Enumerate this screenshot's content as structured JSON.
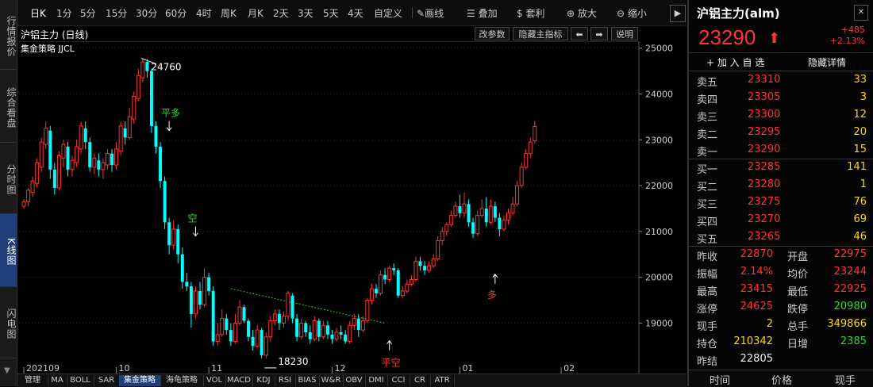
{
  "left_tabs": [
    "行情报价",
    "综合看盘",
    "分时图",
    "K线图",
    "闪电图"
  ],
  "toolbar": {
    "periods": [
      "日K",
      "1分",
      "5分",
      "15分",
      "30分",
      "60分",
      "4时",
      "周K",
      "月K",
      "2天",
      "3天",
      "5天",
      "4天",
      "自定义"
    ],
    "draw": "画线",
    "overlay": "叠加",
    "arbitrage": "套利",
    "zoom_in": "放大",
    "zoom_out": "缩小"
  },
  "chart_header": {
    "title": "沪铝主力 (日线)",
    "indicator": "集金策略 JJCL",
    "buttons": [
      "改参数",
      "隐藏主指标",
      "⬅",
      "➡",
      "说明"
    ]
  },
  "chart_data": {
    "type": "candlestick",
    "ylim": [
      17900,
      25150
    ],
    "y_ticks": [
      19000,
      20000,
      21000,
      22000,
      23000,
      24000,
      25000
    ],
    "x_labels": [
      {
        "label": "202109",
        "index": 0
      },
      {
        "label": "10",
        "index": 21
      },
      {
        "label": "11",
        "index": 42
      },
      {
        "label": "12",
        "index": 70
      },
      {
        "label": "01",
        "index": 99
      },
      {
        "label": "02",
        "index": 122
      }
    ],
    "candles": [
      [
        21550,
        21650,
        21500,
        21700
      ],
      [
        21650,
        21900,
        21550,
        21950
      ],
      [
        21850,
        22100,
        21750,
        22200
      ],
      [
        22050,
        22500,
        21950,
        22600
      ],
      [
        22400,
        22950,
        22300,
        23050
      ],
      [
        22900,
        23250,
        22800,
        23400
      ],
      [
        23200,
        22350,
        22150,
        23300
      ],
      [
        22350,
        21950,
        21800,
        22500
      ],
      [
        21950,
        22650,
        21900,
        22750
      ],
      [
        22600,
        22900,
        22400,
        23000
      ],
      [
        22850,
        22350,
        22200,
        22950
      ],
      [
        22350,
        22550,
        22200,
        22650
      ],
      [
        22500,
        22850,
        22400,
        23000
      ],
      [
        22800,
        23300,
        22700,
        23400
      ],
      [
        23250,
        22950,
        22800,
        23400
      ],
      [
        22950,
        22400,
        22300,
        23050
      ],
      [
        22400,
        22600,
        22250,
        22700
      ],
      [
        22550,
        22350,
        22200,
        22700
      ],
      [
        22350,
        22500,
        22150,
        22600
      ],
      [
        22450,
        22700,
        22350,
        22800
      ],
      [
        22700,
        22450,
        22300,
        22800
      ],
      [
        22450,
        22800,
        22350,
        22950
      ],
      [
        22750,
        23300,
        22650,
        23400
      ],
      [
        23250,
        23050,
        22900,
        23400
      ],
      [
        23050,
        23500,
        23000,
        23700
      ],
      [
        23450,
        23950,
        23350,
        24050
      ],
      [
        23900,
        24400,
        23850,
        24550
      ],
      [
        24350,
        24700,
        24250,
        24760
      ],
      [
        24700,
        24500,
        24350,
        24760
      ],
      [
        24500,
        23300,
        23150,
        24550
      ],
      [
        23300,
        22850,
        22700,
        23400
      ],
      [
        22850,
        22100,
        21950,
        22950
      ],
      [
        22100,
        21200,
        21050,
        22200
      ],
      [
        21200,
        20700,
        20500,
        21300
      ],
      [
        20700,
        21050,
        20600,
        21250
      ],
      [
        21050,
        20500,
        20300,
        21150
      ],
      [
        20500,
        19900,
        19750,
        20650
      ],
      [
        19900,
        19800,
        19700,
        20100
      ],
      [
        19800,
        19200,
        18900,
        19900
      ],
      [
        19200,
        19700,
        19100,
        19800
      ],
      [
        19700,
        19400,
        19300,
        19900
      ],
      [
        19400,
        20000,
        19350,
        20200
      ],
      [
        20000,
        19700,
        19600,
        20100
      ],
      [
        19700,
        18600,
        18500,
        19800
      ],
      [
        18600,
        18750,
        18500,
        19000
      ],
      [
        18750,
        19100,
        18700,
        19300
      ],
      [
        19100,
        18850,
        18750,
        19200
      ],
      [
        18850,
        18600,
        18500,
        19000
      ],
      [
        18600,
        19000,
        18550,
        19200
      ],
      [
        19000,
        19350,
        18950,
        19500
      ],
      [
        19350,
        19050,
        19000,
        19400
      ],
      [
        19050,
        18700,
        18600,
        19100
      ],
      [
        18700,
        18500,
        18400,
        18850
      ],
      [
        18500,
        18850,
        18450,
        18950
      ],
      [
        18850,
        18300,
        18230,
        18900
      ],
      [
        18300,
        18700,
        18230,
        18800
      ],
      [
        18700,
        19050,
        18600,
        19150
      ],
      [
        19050,
        19200,
        18950,
        19300
      ],
      [
        19200,
        19000,
        18850,
        19300
      ],
      [
        19000,
        19150,
        18900,
        19250
      ],
      [
        19150,
        19650,
        19050,
        19700
      ],
      [
        19600,
        19100,
        19000,
        19650
      ],
      [
        19100,
        18700,
        18600,
        19200
      ],
      [
        18700,
        19000,
        18650,
        19100
      ],
      [
        19000,
        18800,
        18700,
        19050
      ],
      [
        18800,
        18650,
        18550,
        18950
      ],
      [
        18650,
        19050,
        18600,
        19150
      ],
      [
        19050,
        18700,
        18600,
        19100
      ],
      [
        18700,
        18950,
        18650,
        19050
      ],
      [
        18950,
        18750,
        18650,
        19050
      ],
      [
        18750,
        18650,
        18550,
        18850
      ],
      [
        18650,
        18800,
        18600,
        18900
      ],
      [
        18800,
        18750,
        18650,
        18950
      ],
      [
        18750,
        18600,
        18550,
        18850
      ],
      [
        18600,
        18950,
        18550,
        19050
      ],
      [
        18950,
        19100,
        18850,
        19200
      ],
      [
        19100,
        18850,
        18700,
        19200
      ],
      [
        18850,
        19050,
        18800,
        19150
      ],
      [
        19050,
        19500,
        19000,
        19550
      ],
      [
        19500,
        19750,
        19400,
        19850
      ],
      [
        19750,
        19650,
        19550,
        19850
      ],
      [
        19650,
        20050,
        19600,
        20150
      ],
      [
        20050,
        19950,
        19850,
        20200
      ],
      [
        19950,
        20200,
        19900,
        20250
      ],
      [
        20200,
        20150,
        20050,
        20300
      ],
      [
        20150,
        19600,
        19550,
        20200
      ],
      [
        19600,
        19700,
        19550,
        19800
      ],
      [
        19700,
        19850,
        19650,
        19950
      ],
      [
        19850,
        19950,
        19800,
        20050
      ],
      [
        19950,
        20350,
        19900,
        20450
      ],
      [
        20350,
        20250,
        20150,
        20450
      ],
      [
        20250,
        20150,
        20050,
        20350
      ],
      [
        20150,
        20250,
        20100,
        20350
      ],
      [
        20250,
        20400,
        20200,
        20500
      ],
      [
        20400,
        20800,
        20350,
        20900
      ],
      [
        20800,
        21000,
        20700,
        21100
      ],
      [
        21000,
        21150,
        20900,
        21200
      ],
      [
        21150,
        21350,
        21100,
        21450
      ],
      [
        21350,
        21550,
        21300,
        21650
      ],
      [
        21550,
        21400,
        21300,
        21800
      ],
      [
        21400,
        21600,
        21300,
        21850
      ],
      [
        21600,
        21200,
        21100,
        21700
      ],
      [
        21200,
        20950,
        20850,
        21300
      ],
      [
        20950,
        21350,
        20900,
        21450
      ],
      [
        21350,
        21500,
        21300,
        21700
      ],
      [
        21500,
        21200,
        21100,
        21750
      ],
      [
        21200,
        21550,
        21150,
        21700
      ],
      [
        21550,
        21300,
        21200,
        21650
      ],
      [
        21300,
        21050,
        20900,
        21400
      ],
      [
        21050,
        21250,
        21000,
        21350
      ],
      [
        21250,
        21400,
        21150,
        21500
      ],
      [
        21400,
        21600,
        21350,
        21750
      ],
      [
        21600,
        22000,
        21550,
        22100
      ],
      [
        22000,
        22400,
        21950,
        22500
      ],
      [
        22400,
        22700,
        22350,
        22800
      ],
      [
        22700,
        22950,
        22600,
        23050
      ],
      [
        22975,
        23290,
        22925,
        23415
      ]
    ],
    "annotations": {
      "high_label": "24760",
      "low_label": "18230",
      "signals": [
        "平多",
        "空",
        "平空",
        "多"
      ]
    }
  },
  "indicator_tabs": [
    "管理",
    "MA",
    "BOLL",
    "SAR",
    "集金策略",
    "海龟策略",
    "VOL",
    "MACD",
    "KDJ",
    "RSI",
    "BIAS",
    "W&R",
    "OBV",
    "DMI",
    "CCI",
    "CR",
    "ATR"
  ],
  "quote": {
    "title": "沪铝主力(alm)",
    "price": "23290",
    "change": "+485",
    "change_pct": "+2.13%",
    "add_favorite": "+ 加 入 自 选",
    "hide_detail": "隐藏详情",
    "asks": [
      {
        "label": "卖五",
        "price": "23310",
        "vol": "33"
      },
      {
        "label": "卖四",
        "price": "23305",
        "vol": "3"
      },
      {
        "label": "卖三",
        "price": "23300",
        "vol": "12"
      },
      {
        "label": "卖二",
        "price": "23295",
        "vol": "20"
      },
      {
        "label": "卖一",
        "price": "23290",
        "vol": "15"
      }
    ],
    "bids": [
      {
        "label": "买一",
        "price": "23285",
        "vol": "141"
      },
      {
        "label": "买二",
        "price": "23280",
        "vol": "1"
      },
      {
        "label": "买三",
        "price": "23275",
        "vol": "76"
      },
      {
        "label": "买四",
        "price": "23270",
        "vol": "69"
      },
      {
        "label": "买五",
        "price": "23265",
        "vol": "46"
      }
    ],
    "stats": [
      {
        "l1": "昨收",
        "v1": "22870",
        "c1": "red",
        "l2": "开盘",
        "v2": "22975",
        "c2": "red"
      },
      {
        "l1": "振幅",
        "v1": "2.14%",
        "c1": "red",
        "l2": "均价",
        "v2": "23244",
        "c2": "red"
      },
      {
        "l1": "最高",
        "v1": "23415",
        "c1": "red",
        "l2": "最低",
        "v2": "22925",
        "c2": "red"
      },
      {
        "l1": "涨停",
        "v1": "24625",
        "c1": "red",
        "l2": "跌停",
        "v2": "20980",
        "c2": "green"
      },
      {
        "l1": "现手",
        "v1": "2",
        "c1": "yellow",
        "l2": "总手",
        "v2": "349866",
        "c2": "yellow"
      },
      {
        "l1": "持仓",
        "v1": "210342",
        "c1": "yellow",
        "l2": "日增",
        "v2": "2385",
        "c2": "green"
      },
      {
        "l1": "昨结",
        "v1": "22805",
        "c1": "white",
        "l2": "",
        "v2": "",
        "c2": "white"
      }
    ],
    "footer_tabs": [
      "时间",
      "价格",
      "现手"
    ]
  },
  "colors": {
    "up": "#ff3333",
    "down": "#00ffff",
    "grid": "#333333",
    "accent": "#1e3f7a"
  }
}
